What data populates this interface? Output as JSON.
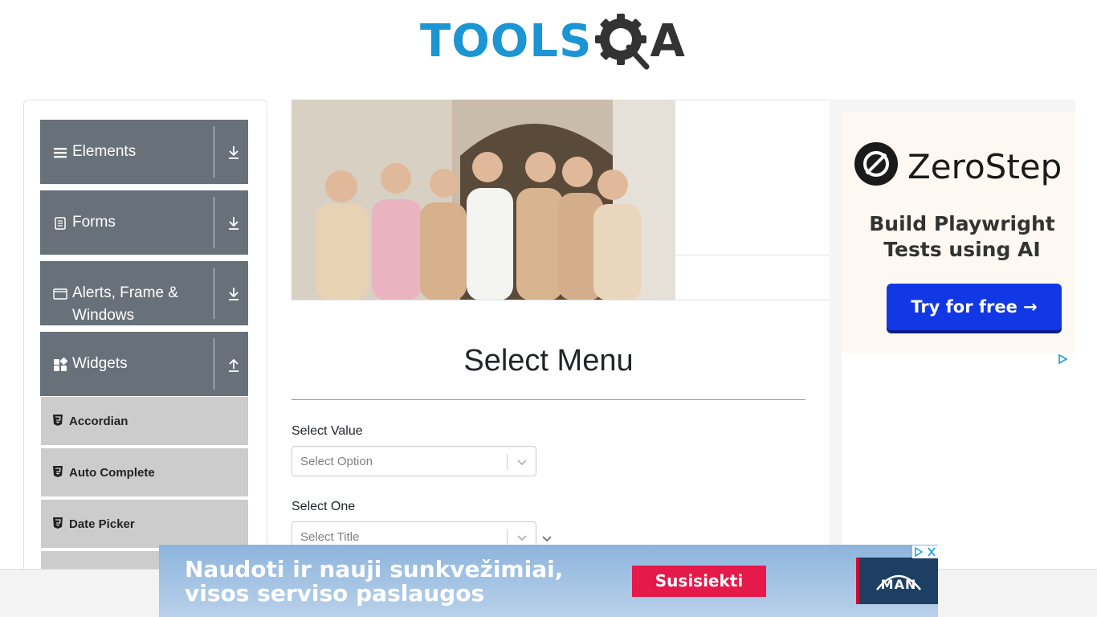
{
  "header": {
    "logo_left": "TOOLS",
    "logo_right": "A",
    "brand_color": "#1b95d3"
  },
  "sidebar": {
    "groups": [
      {
        "label": "Elements",
        "icon": "list-icon",
        "state": "collapsed"
      },
      {
        "label": "Forms",
        "icon": "form-icon",
        "state": "collapsed"
      },
      {
        "label": "Alerts, Frame & Windows",
        "icon": "window-icon",
        "state": "collapsed"
      },
      {
        "label": "Widgets",
        "icon": "widgets-icon",
        "state": "expanded"
      }
    ],
    "items": [
      {
        "label": "Accordian"
      },
      {
        "label": "Auto Complete"
      },
      {
        "label": "Date Picker"
      }
    ],
    "group_color": "#687179",
    "item_color": "#cccccc"
  },
  "main": {
    "title": "Select Menu",
    "fields": [
      {
        "label": "Select Value",
        "placeholder": "Select Option"
      },
      {
        "label": "Select One",
        "placeholder": "Select Title"
      }
    ]
  },
  "ad_right": {
    "brand": "ZeroStep",
    "tagline_line1": "Build Playwright",
    "tagline_line2": "Tests using AI",
    "button": "Try for free →",
    "button_color": "#1238e6"
  },
  "ad_bottom": {
    "line1": "Naudoti ir nauji sunkvežimiai,",
    "line2": "visos serviso paslaugos",
    "cta": "Susisiekti",
    "brand": "MAN",
    "cta_color": "#e5194a"
  }
}
